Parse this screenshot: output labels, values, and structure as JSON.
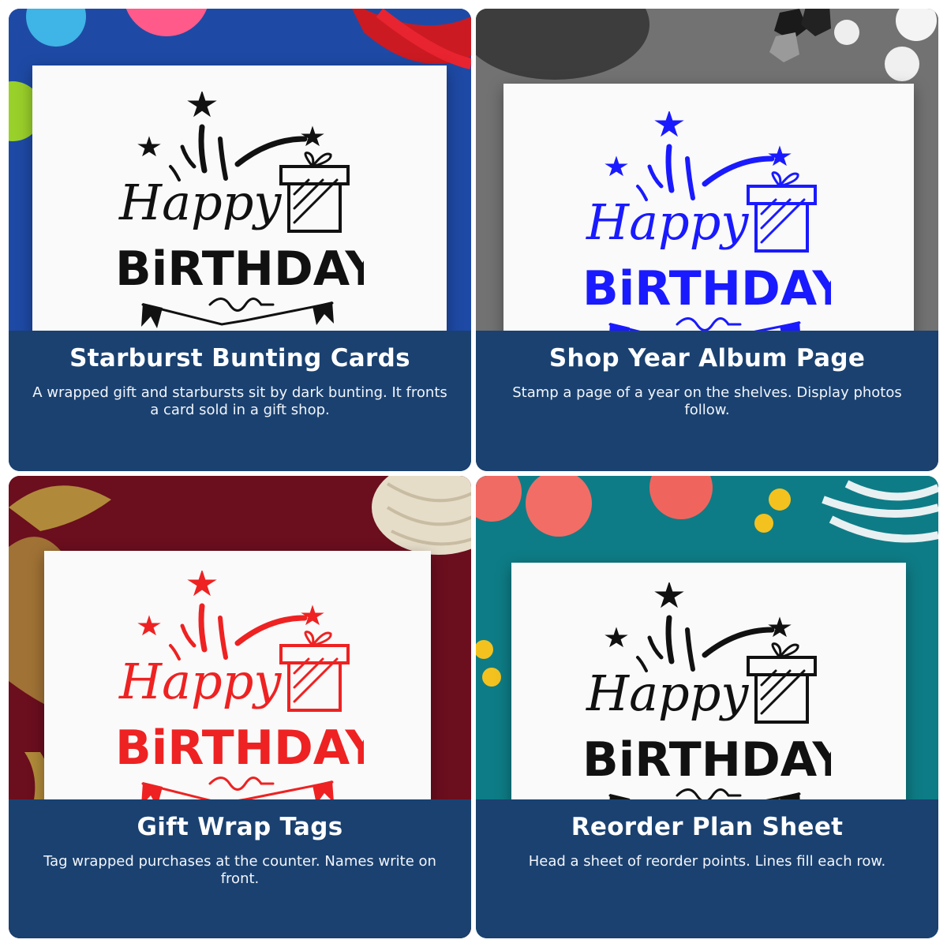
{
  "tiles": [
    {
      "title": "Starburst Bunting Cards",
      "description": "A wrapped gift and starbursts sit by dark bunting. It fronts a card sold in a gift shop.",
      "ink_color": "#111111",
      "background": "blue fabric with colored paper circles and red ribbon"
    },
    {
      "title": "Shop Year Album Page",
      "description": "Stamp a page of a year on the shelves. Display photos follow.",
      "ink_color": "#1a1aff",
      "background": "grey felt with yarn, beads and white buttons"
    },
    {
      "title": "Gift Wrap Tags",
      "description": "Tag wrapped purchases at the counter. Names write on front.",
      "ink_color": "#ee2222",
      "background": "dark red fabric with gold ribbon, twine and scissors"
    },
    {
      "title": "Reorder Plan Sheet",
      "description": "Head a sheet of reorder points. Lines fill each row.",
      "ink_color": "#111111",
      "background": "teal felt with coral pom-poms, yellow beads and white yarn"
    }
  ],
  "stamp": {
    "line1": "Happy",
    "line2": "BiRTHDAY"
  }
}
